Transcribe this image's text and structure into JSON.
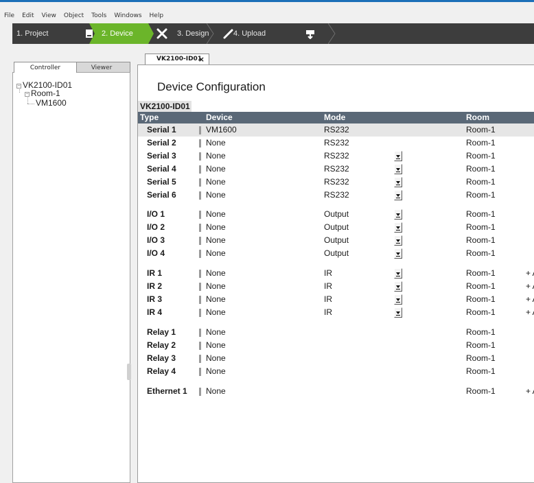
{
  "menu": [
    "File",
    "Edit",
    "View",
    "Object",
    "Tools",
    "Windows",
    "Help"
  ],
  "steps": [
    {
      "label": "1. Project",
      "icon": "device-icon"
    },
    {
      "label": "2. Device",
      "icon": "tools-icon"
    },
    {
      "label": "3. Design",
      "icon": "brush-icon"
    },
    {
      "label": "4. Upload",
      "icon": "upload-icon"
    }
  ],
  "sidebar": {
    "tabs": [
      "Controller",
      "Viewer"
    ],
    "tree": {
      "root": "VK2100-ID01",
      "room": "Room-1",
      "device": "VM1600"
    }
  },
  "document_tab": {
    "label": "VK2100-ID01",
    "close": "×"
  },
  "page": {
    "title": "Device Configuration",
    "controller": "VK2100-ID01",
    "columns": {
      "type": "Type",
      "device": "Device",
      "mode": "Mode",
      "room": "Room"
    }
  },
  "rows": [
    {
      "type": "Serial 1",
      "device": "VM1600",
      "mode": "RS232",
      "dropdown": false,
      "room": "Room-1",
      "extra": ""
    },
    {
      "type": "Serial 2",
      "device": "None",
      "mode": "RS232",
      "dropdown": false,
      "room": "Room-1",
      "extra": ""
    },
    {
      "type": "Serial 3",
      "device": "None",
      "mode": "RS232",
      "dropdown": true,
      "room": "Room-1",
      "extra": ""
    },
    {
      "type": "Serial 4",
      "device": "None",
      "mode": "RS232",
      "dropdown": true,
      "room": "Room-1",
      "extra": ""
    },
    {
      "type": "Serial 5",
      "device": "None",
      "mode": "RS232",
      "dropdown": true,
      "room": "Room-1",
      "extra": ""
    },
    {
      "type": "Serial 6",
      "device": "None",
      "mode": "RS232",
      "dropdown": true,
      "room": "Room-1",
      "extra": ""
    },
    {
      "type": "I/O 1",
      "device": "None",
      "mode": "Output",
      "dropdown": true,
      "room": "Room-1",
      "extra": ""
    },
    {
      "type": "I/O 2",
      "device": "None",
      "mode": "Output",
      "dropdown": true,
      "room": "Room-1",
      "extra": ""
    },
    {
      "type": "I/O 3",
      "device": "None",
      "mode": "Output",
      "dropdown": true,
      "room": "Room-1",
      "extra": ""
    },
    {
      "type": "I/O 4",
      "device": "None",
      "mode": "Output",
      "dropdown": true,
      "room": "Room-1",
      "extra": ""
    },
    {
      "type": "IR 1",
      "device": "None",
      "mode": "IR",
      "dropdown": true,
      "room": "Room-1",
      "extra": "+ A"
    },
    {
      "type": "IR 2",
      "device": "None",
      "mode": "IR",
      "dropdown": true,
      "room": "Room-1",
      "extra": "+ A"
    },
    {
      "type": "IR 3",
      "device": "None",
      "mode": "IR",
      "dropdown": true,
      "room": "Room-1",
      "extra": "+ A"
    },
    {
      "type": "IR 4",
      "device": "None",
      "mode": "IR",
      "dropdown": true,
      "room": "Room-1",
      "extra": "+ A"
    },
    {
      "type": "Relay 1",
      "device": "None",
      "mode": "",
      "dropdown": false,
      "room": "Room-1",
      "extra": ""
    },
    {
      "type": "Relay 2",
      "device": "None",
      "mode": "",
      "dropdown": false,
      "room": "Room-1",
      "extra": ""
    },
    {
      "type": "Relay 3",
      "device": "None",
      "mode": "",
      "dropdown": false,
      "room": "Room-1",
      "extra": ""
    },
    {
      "type": "Relay 4",
      "device": "None",
      "mode": "",
      "dropdown": false,
      "room": "Room-1",
      "extra": ""
    },
    {
      "type": "Ethernet 1",
      "device": "None",
      "mode": "",
      "dropdown": false,
      "room": "Room-1",
      "extra": "+ A"
    }
  ],
  "colors": {
    "accent_blue": "#1c6fb8",
    "step_bar": "#3d3d3d",
    "active_step": "#6bb52a",
    "table_header": "#5a6877",
    "highlight_row": "#e6e6e6"
  }
}
